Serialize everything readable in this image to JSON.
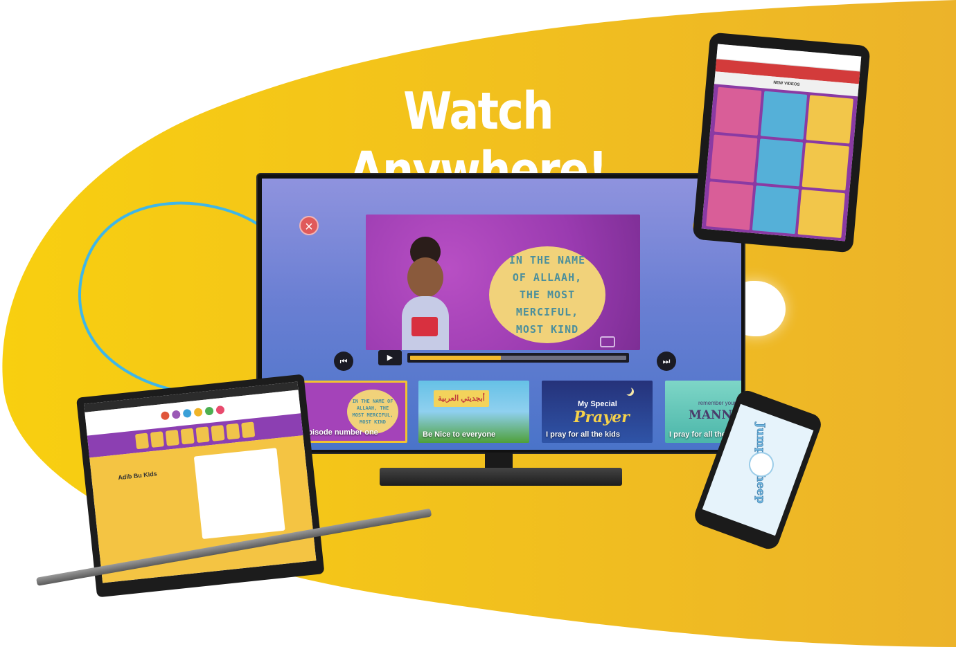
{
  "headline": "Watch Anywhere!",
  "colors": {
    "brand_yellow": "#f6c316",
    "accent_purple": "#9a3bb0",
    "progress": "#f2b92e"
  },
  "tv": {
    "close_icon": "close-icon",
    "video_text": "IN THE NAME OF ALLAAH, THE MOST MERCIFUL, MOST KIND",
    "controls": {
      "prev_icon": "skip-previous-icon",
      "play_icon": "play-icon",
      "next_icon": "skip-next-icon"
    },
    "progress": 0.42,
    "thumbnails": [
      {
        "caption": "Episode number one",
        "bubble": "IN THE NAME OF ALLAAH, THE MOST MERCIFUL, MOST KIND",
        "active": true
      },
      {
        "caption": "Be Nice to everyone",
        "flag": "أبجديتي العربية"
      },
      {
        "caption": "I pray for all the kids",
        "title_top": "My Special",
        "title_main": "Prayer"
      },
      {
        "caption": "I pray for all the kids",
        "title_top": "remember your",
        "title_main": "MANNER"
      }
    ]
  },
  "tablet": {
    "section_title": "NEW VIDEOS"
  },
  "laptop": {
    "page_title": "Adib Bu Kids"
  },
  "phone": {
    "game_title": "Jumpy Sheep"
  }
}
